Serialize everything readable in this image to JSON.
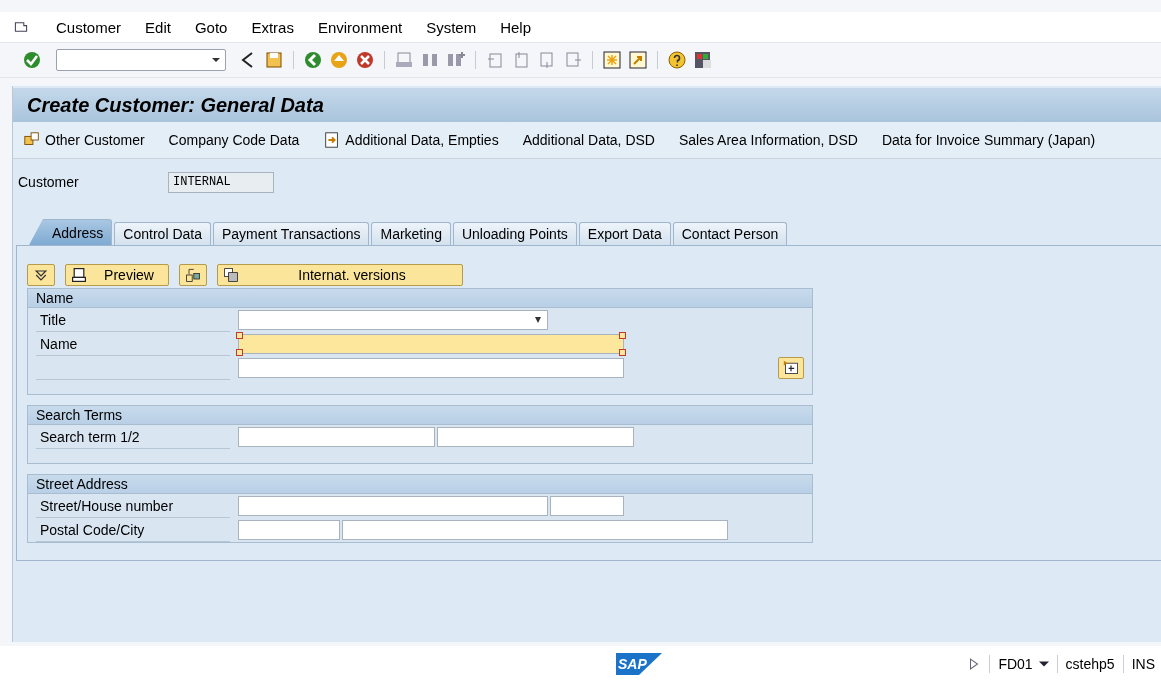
{
  "menu_bar": [
    {
      "label": "Customer"
    },
    {
      "label": "Edit"
    },
    {
      "label": "Goto"
    },
    {
      "label": "Extras"
    },
    {
      "label": "Environment"
    },
    {
      "label": "System"
    },
    {
      "label": "Help"
    }
  ],
  "title": "Create Customer: General Data",
  "app_toolbar": [
    {
      "kind": "icon-text",
      "label": "Other Customer"
    },
    {
      "kind": "text",
      "label": "Company Code Data"
    },
    {
      "kind": "icon-text",
      "label": "Additional Data, Empties"
    },
    {
      "kind": "text",
      "label": "Additional Data, DSD"
    },
    {
      "kind": "text",
      "label": "Sales Area Information, DSD"
    },
    {
      "kind": "text",
      "label": "Data for Invoice Summary (Japan)"
    }
  ],
  "customer": {
    "label": "Customer",
    "value": "INTERNAL"
  },
  "tabs": [
    {
      "label": "Address",
      "selected": true
    },
    {
      "label": "Control Data",
      "selected": false
    },
    {
      "label": "Payment Transactions",
      "selected": false
    },
    {
      "label": "Marketing",
      "selected": false
    },
    {
      "label": "Unloading Points",
      "selected": false
    },
    {
      "label": "Export Data",
      "selected": false
    },
    {
      "label": "Contact Person",
      "selected": false
    }
  ],
  "tab_buttons": [
    {
      "kind": "icon"
    },
    {
      "kind": "icon-text",
      "label": "Preview"
    },
    {
      "kind": "icon"
    },
    {
      "kind": "wide",
      "label": "Internat. versions"
    }
  ],
  "groups": [
    {
      "title": "Name",
      "rows": [
        {
          "label": "Title",
          "fields": [
            {
              "kind": "dropdown",
              "focused": false
            }
          ]
        },
        {
          "label": "Name",
          "fields": [
            {
              "kind": "long",
              "focused": true
            }
          ]
        },
        {
          "fields": [
            {
              "kind": "long",
              "focused": false
            }
          ]
        }
      ]
    },
    {
      "title": "Search Terms",
      "rows": [
        {
          "label": "Search term 1/2",
          "fields": [
            {
              "kind": "medium",
              "focused": false
            },
            {
              "kind": "medium",
              "focused": false
            }
          ]
        }
      ]
    },
    {
      "title": "Street Address",
      "rows": [
        {
          "label": "Street/House number",
          "fields": [
            {
              "kind": "dropdown-plain",
              "focused": false
            },
            {
              "kind": "tiny",
              "focused": false
            }
          ]
        },
        {
          "label": "Postal Code/City",
          "fields": [
            {
              "kind": "short",
              "focused": false
            },
            {
              "kind": "long",
              "focused": false
            }
          ]
        }
      ]
    }
  ],
  "status_bar": {
    "logo": "SAP",
    "transaction": "FD01",
    "server": "cstehp5",
    "mode": "INS"
  }
}
